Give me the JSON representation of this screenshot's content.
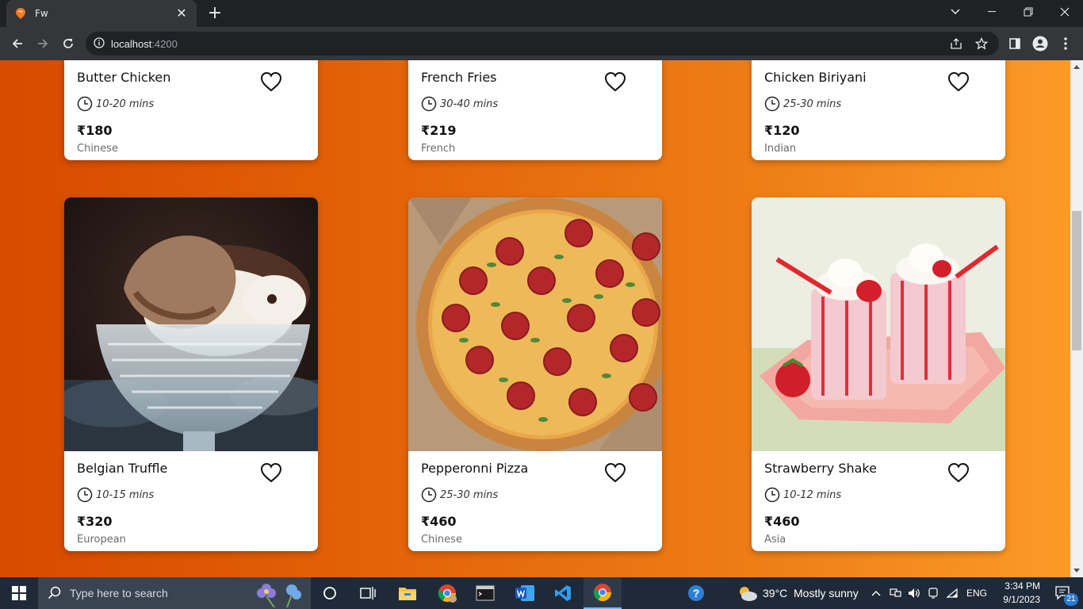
{
  "browser": {
    "tab_title": "Fw",
    "tab_close": "✕",
    "new_tab": "+",
    "url_host": "localhost",
    "url_port": ":4200"
  },
  "cards": [
    {
      "name": "Butter Chicken",
      "time": "10-20 mins",
      "price": "₹180",
      "cuisine": "Chinese"
    },
    {
      "name": "French Fries",
      "time": "30-40 mins",
      "price": "₹219",
      "cuisine": "French"
    },
    {
      "name": "Chicken Biriyani",
      "time": "25-30 mins",
      "price": "₹120",
      "cuisine": "Indian"
    },
    {
      "name": "Belgian Truffle",
      "time": "10-15 mins",
      "price": "₹320",
      "cuisine": "European",
      "image": "ice-cream-bowl"
    },
    {
      "name": "Pepperonni Pizza",
      "time": "25-30 mins",
      "price": "₹460",
      "cuisine": "Chinese",
      "image": "pepperoni-pizza"
    },
    {
      "name": "Strawberry Shake",
      "time": "10-12 mins",
      "price": "₹460",
      "cuisine": "Asia",
      "image": "strawberry-shakes"
    }
  ],
  "taskbar": {
    "search_placeholder": "Type here to search",
    "temperature": "39°C",
    "weather": "Mostly sunny",
    "language": "ENG",
    "time": "3:34 PM",
    "date": "9/1/2023",
    "notification_count": "21"
  },
  "colors": {
    "page_gradient_start": "#d84a00",
    "page_gradient_end": "#fb9a27"
  }
}
